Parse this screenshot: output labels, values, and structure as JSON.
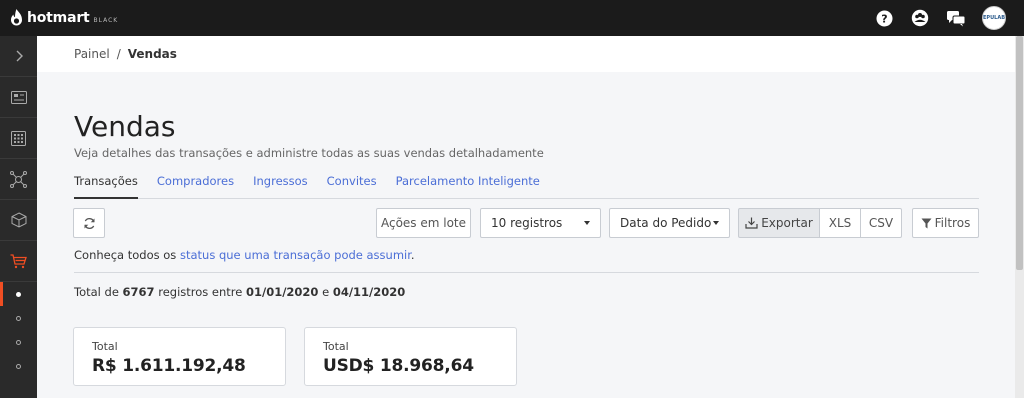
{
  "topbar": {
    "brand": "hotmart",
    "tier": "BLACK",
    "icons": [
      "help-icon",
      "community-icon",
      "chat-icon"
    ],
    "avatar_text": "EPULAB"
  },
  "sidebar": {
    "items": [
      "expand-icon",
      "dashboard-icon",
      "apps-grid-icon",
      "affiliate-icon",
      "product-box-icon",
      "cart-icon"
    ],
    "subitems": 4
  },
  "breadcrumb": {
    "parent": "Painel",
    "separator": "/",
    "current": "Vendas"
  },
  "page": {
    "title": "Vendas",
    "subtitle": "Veja detalhes das transações e administre todas as suas vendas detalhadamente"
  },
  "tabs": [
    {
      "label": "Transações",
      "active": true
    },
    {
      "label": "Compradores"
    },
    {
      "label": "Ingressos"
    },
    {
      "label": "Convites"
    },
    {
      "label": "Parcelamento Inteligente"
    }
  ],
  "toolbar": {
    "acoes_label": "Ações em lote",
    "registros_value": "10 registros",
    "data_value": "Data do Pedido",
    "exportar_label": "Exportar",
    "xls_label": "XLS",
    "csv_label": "CSV",
    "filtros_label": "Filtros"
  },
  "notice": {
    "prefix": "Conheça todos os ",
    "link": "status que uma transação pode assumir",
    "suffix": "."
  },
  "summary": {
    "prefix": "Total de ",
    "count": "6767",
    "mid": " registros entre ",
    "start_date": "01/01/2020",
    "conj": " e ",
    "end_date": "04/11/2020"
  },
  "cards": [
    {
      "label": "Total",
      "value": "R$ 1.611.192,48"
    },
    {
      "label": "Total",
      "value": "USD$ 18.968,64"
    }
  ],
  "colors": {
    "accent": "#4b6ed6",
    "brand": "#f04e23",
    "topbar": "#1b1b1b"
  }
}
